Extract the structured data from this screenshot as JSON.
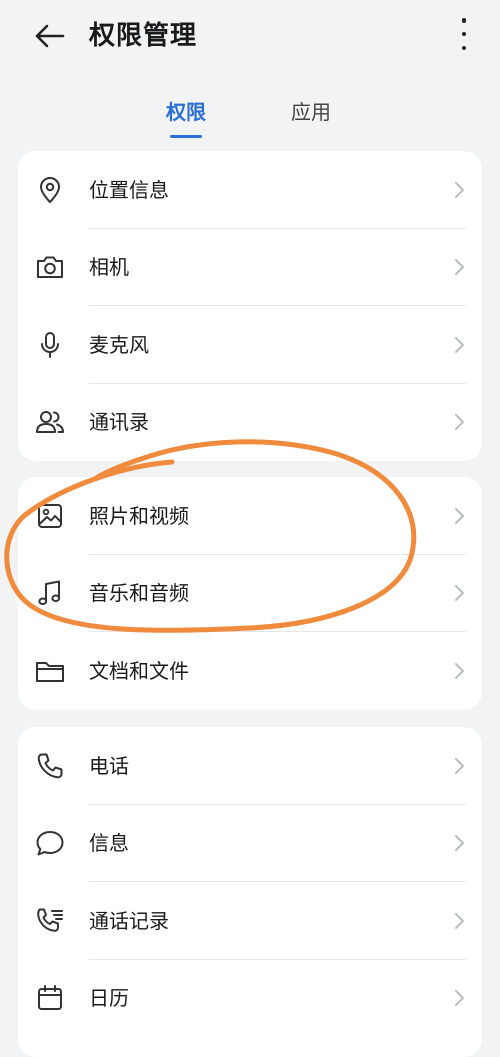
{
  "header": {
    "title": "权限管理",
    "back_icon": "arrow-left-icon",
    "more_icon": "more-vertical-icon"
  },
  "tabs": [
    {
      "label": "权限",
      "active": true
    },
    {
      "label": "应用",
      "active": false
    }
  ],
  "accent_color": "#2b6fd6",
  "annotation_color": "#f08a3c",
  "groups": [
    {
      "items": [
        {
          "label": "位置信息",
          "icon": "location-pin-icon"
        },
        {
          "label": "相机",
          "icon": "camera-icon"
        },
        {
          "label": "麦克风",
          "icon": "microphone-icon"
        },
        {
          "label": "通讯录",
          "icon": "contacts-icon"
        }
      ]
    },
    {
      "items": [
        {
          "label": "照片和视频",
          "icon": "image-icon"
        },
        {
          "label": "音乐和音频",
          "icon": "music-note-icon"
        },
        {
          "label": "文档和文件",
          "icon": "folder-icon"
        }
      ]
    },
    {
      "items": [
        {
          "label": "电话",
          "icon": "phone-icon"
        },
        {
          "label": "信息",
          "icon": "message-bubble-icon"
        },
        {
          "label": "通话记录",
          "icon": "call-log-icon"
        },
        {
          "label": "日历",
          "icon": "calendar-icon"
        }
      ]
    }
  ]
}
